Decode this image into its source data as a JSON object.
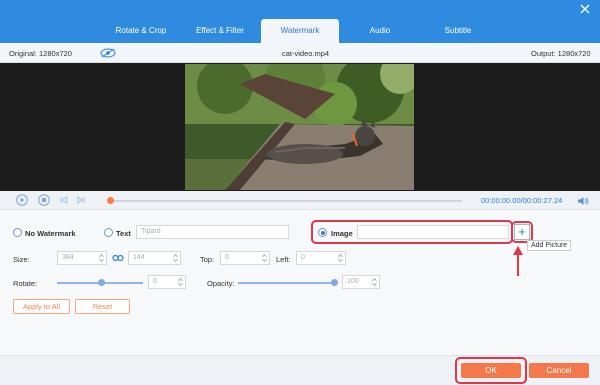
{
  "tabs": [
    {
      "label": "Rotate & Crop"
    },
    {
      "label": "Effect & Filter"
    },
    {
      "label": "Watermark"
    },
    {
      "label": "Audio"
    },
    {
      "label": "Subtitle"
    }
  ],
  "active_tab": "Watermark",
  "info": {
    "original": "Original: 1280x720",
    "filename": "cat-video.mp4",
    "output": "Output: 1280x720"
  },
  "player": {
    "time": "00:00:00.00/00:00:27.24",
    "progress": 0
  },
  "watermark": {
    "no_watermark_label": "No Watermark",
    "text_label": "Text",
    "text_placeholder": "Tipard",
    "image_label": "Image",
    "image_value": "",
    "add_picture_tooltip": "Add Picture",
    "selected": "Image"
  },
  "params": {
    "size_label": "Size:",
    "width": "384",
    "height": "144",
    "top_label": "Top:",
    "top": "0",
    "left_label": "Left:",
    "left": "0",
    "rotate_label": "Rotate:",
    "rotate": "0",
    "opacity_label": "Opacity:",
    "opacity": "100"
  },
  "buttons": {
    "apply_all": "Apply to All",
    "reset": "Reset",
    "ok": "OK",
    "cancel": "Cancel"
  },
  "colors": {
    "title_bar": "#2f8bdf",
    "accent": "#f5784a",
    "highlight": "#e0364a",
    "link_blue": "#2a7fe0"
  }
}
